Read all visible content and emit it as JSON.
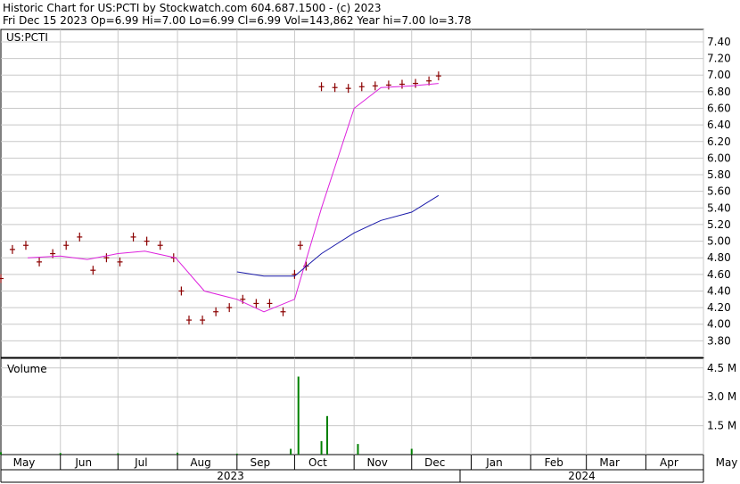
{
  "header": {
    "line1": "Historic Chart for US:PCTI by Stockwatch.com 604.687.1500 - (c) 2023",
    "line2": "Fri Dec 15 2023  Op=6.99  Hi=7.00  Lo=6.99  Cl=6.99  Vol=143,862  Year hi=7.00  lo=3.78"
  },
  "chart_data": {
    "type": "line",
    "title": "US:PCTI",
    "price_axis": {
      "ylim": [
        3.6,
        7.55
      ],
      "ticks": [
        "3.80",
        "4.00",
        "4.20",
        "4.40",
        "4.60",
        "4.80",
        "5.00",
        "5.20",
        "5.40",
        "5.60",
        "5.80",
        "6.00",
        "6.20",
        "6.40",
        "6.60",
        "6.80",
        "7.00",
        "7.20",
        "7.40"
      ]
    },
    "volume_panel": {
      "label": "Volume",
      "ylim": [
        0,
        5.0
      ],
      "ticks": [
        "1.5 M",
        "3.0 M",
        "4.5 M"
      ]
    },
    "x_axis": {
      "months": [
        "May",
        "Jun",
        "Jul",
        "Aug",
        "Sep",
        "Oct",
        "Nov",
        "Dec",
        "Jan",
        "Feb",
        "Mar",
        "Apr",
        "May"
      ],
      "years": [
        "2023",
        "2024"
      ]
    },
    "grid": true,
    "series": [
      {
        "style": "ohlc-bars",
        "color": "#8b0000",
        "x": [
          "2023-05-01",
          "2023-05-07",
          "2023-05-14",
          "2023-05-21",
          "2023-05-28",
          "2023-06-04",
          "2023-06-11",
          "2023-06-18",
          "2023-06-25",
          "2023-07-02",
          "2023-07-09",
          "2023-07-16",
          "2023-07-23",
          "2023-07-30",
          "2023-08-03",
          "2023-08-07",
          "2023-08-14",
          "2023-08-21",
          "2023-08-28",
          "2023-09-04",
          "2023-09-11",
          "2023-09-18",
          "2023-09-25",
          "2023-10-01",
          "2023-10-04",
          "2023-10-07",
          "2023-10-15",
          "2023-10-22",
          "2023-10-29",
          "2023-11-05",
          "2023-11-12",
          "2023-11-19",
          "2023-11-26",
          "2023-12-03",
          "2023-12-10",
          "2023-12-15"
        ],
        "y": [
          4.55,
          4.9,
          4.95,
          4.75,
          4.85,
          4.95,
          5.05,
          4.65,
          4.8,
          4.75,
          5.05,
          5.0,
          4.95,
          4.8,
          4.4,
          4.05,
          4.05,
          4.15,
          4.2,
          4.3,
          4.25,
          4.25,
          4.15,
          4.6,
          4.95,
          4.7,
          6.86,
          6.85,
          6.84,
          6.86,
          6.87,
          6.88,
          6.89,
          6.9,
          6.93,
          6.99
        ]
      },
      {
        "style": "moving-average",
        "color": "#dd22dd",
        "x": [
          "2023-05-15",
          "2023-06-01",
          "2023-06-15",
          "2023-07-01",
          "2023-07-15",
          "2023-07-31",
          "2023-08-15",
          "2023-09-01",
          "2023-09-15",
          "2023-10-01",
          "2023-10-15",
          "2023-11-01",
          "2023-11-15",
          "2023-12-01",
          "2023-12-15"
        ],
        "y": [
          4.8,
          4.82,
          4.78,
          4.85,
          4.88,
          4.8,
          4.4,
          4.3,
          4.15,
          4.3,
          5.4,
          6.6,
          6.85,
          6.87,
          6.9
        ]
      },
      {
        "style": "moving-average",
        "color": "#1a1aaa",
        "x": [
          "2023-09-01",
          "2023-09-15",
          "2023-10-01",
          "2023-10-15",
          "2023-11-01",
          "2023-11-15",
          "2023-12-01",
          "2023-12-15"
        ],
        "y": [
          4.63,
          4.58,
          4.58,
          4.85,
          5.1,
          5.25,
          5.35,
          5.55
        ]
      },
      {
        "style": "volume-bars",
        "color": "#008000",
        "x": [
          "2023-05-01",
          "2023-06-01",
          "2023-07-01",
          "2023-08-01",
          "2023-09-01",
          "2023-09-29",
          "2023-10-03",
          "2023-10-15",
          "2023-10-18",
          "2023-11-03",
          "2023-12-01"
        ],
        "y": [
          0.12,
          0.08,
          0.07,
          0.1,
          0.05,
          0.3,
          4.05,
          0.7,
          2.0,
          0.55,
          0.3
        ]
      }
    ]
  }
}
